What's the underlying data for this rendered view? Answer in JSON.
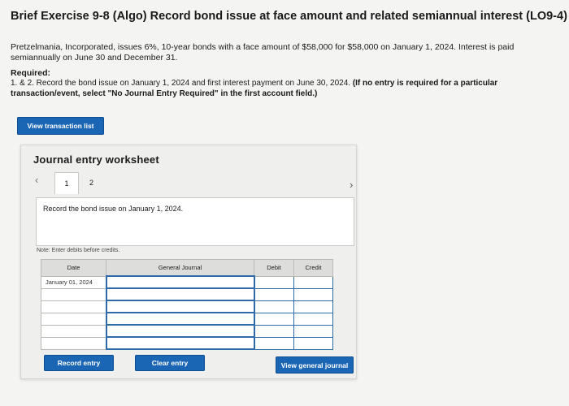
{
  "header": {
    "title": "Brief Exercise 9-8 (Algo) Record bond issue at face amount and related semiannual interest (LO9-4)"
  },
  "problem": {
    "text": "Pretzelmania, Incorporated, issues 6%, 10-year bonds with a face amount of $58,000 for $58,000 on January 1, 2024. Interest is paid semiannually on June 30 and December 31."
  },
  "required": {
    "heading": "Required:",
    "text": "1. & 2. Record the bond issue on January 1, 2024 and first interest payment on June 30, 2024.",
    "instruction": "(If no entry is required for a particular transaction/event, select \"No Journal Entry Required\" in the first account field.)"
  },
  "buttons": {
    "view_transaction_list": "View transaction list",
    "record_entry": "Record entry",
    "clear_entry": "Clear entry",
    "view_general_journal": "View general journal"
  },
  "worksheet": {
    "title": "Journal entry worksheet",
    "tabs": [
      "1",
      "2"
    ],
    "prev_icon": "‹",
    "next_icon": "›",
    "description": "Record the bond issue on January 1, 2024.",
    "note": "Note: Enter debits before credits."
  },
  "table": {
    "headers": [
      "Date",
      "General Journal",
      "Debit",
      "Credit"
    ],
    "rows": [
      {
        "date": "January 01, 2024",
        "account": "",
        "debit": "",
        "credit": ""
      },
      {
        "date": "",
        "account": "",
        "debit": "",
        "credit": ""
      },
      {
        "date": "",
        "account": "",
        "debit": "",
        "credit": ""
      },
      {
        "date": "",
        "account": "",
        "debit": "",
        "credit": ""
      },
      {
        "date": "",
        "account": "",
        "debit": "",
        "credit": ""
      },
      {
        "date": "",
        "account": "",
        "debit": "",
        "credit": ""
      }
    ]
  }
}
